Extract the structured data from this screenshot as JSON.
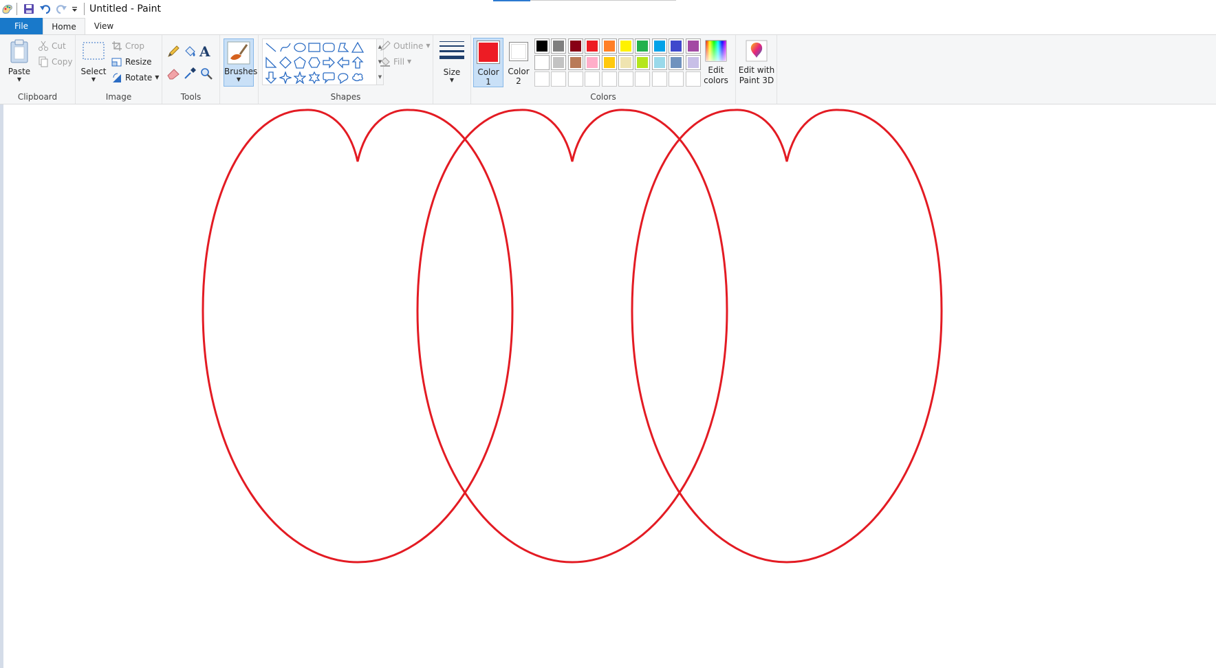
{
  "window": {
    "title": "Untitled - Paint"
  },
  "quick_access": {
    "icons": [
      "paint-app-icon",
      "save-icon",
      "undo-icon",
      "redo-icon",
      "customize-dropdown-icon"
    ]
  },
  "tabs": [
    {
      "label": "File",
      "active": false,
      "highlight": true
    },
    {
      "label": "Home",
      "active": true
    },
    {
      "label": "View",
      "active": false
    }
  ],
  "ribbon": {
    "clipboard": {
      "label": "Clipboard",
      "paste": "Paste",
      "cut": "Cut",
      "copy": "Copy"
    },
    "image": {
      "label": "Image",
      "select": "Select",
      "crop": "Crop",
      "resize": "Resize",
      "rotate": "Rotate"
    },
    "tools": {
      "label": "Tools",
      "icons": [
        "pencil-icon",
        "fill-bucket-icon",
        "text-icon",
        "eraser-icon",
        "color-picker-icon",
        "magnifier-icon"
      ]
    },
    "brushes": {
      "label": "Brushes"
    },
    "shapes": {
      "label": "Shapes",
      "outline": "Outline",
      "fill": "Fill",
      "items": [
        "line",
        "curve",
        "oval",
        "rectangle",
        "rounded-rectangle",
        "polygon",
        "triangle",
        "right-triangle",
        "diamond",
        "pentagon",
        "hexagon",
        "right-arrow",
        "left-arrow",
        "up-arrow",
        "down-arrow",
        "four-point-star",
        "five-point-star",
        "six-point-star",
        "rounded-callout",
        "oval-callout",
        "cloud-callout"
      ]
    },
    "size": {
      "label": "Size"
    },
    "colors": {
      "label": "Colors",
      "color1_label_line1": "Color",
      "color1_label_line2": "1",
      "color2_label_line1": "Color",
      "color2_label_line2": "2",
      "color1": "#ed1c24",
      "color2": "#ffffff",
      "palette_row1": [
        "#000000",
        "#7f7f7f",
        "#880015",
        "#ed1c24",
        "#ff7f27",
        "#fff200",
        "#22b14c",
        "#00a2e8",
        "#3f48cc",
        "#a349a4"
      ],
      "palette_row2": [
        "#ffffff",
        "#c3c3c3",
        "#b97a57",
        "#ffaec9",
        "#ffc90e",
        "#efe4b0",
        "#b5e61d",
        "#99d9ea",
        "#7092be",
        "#c8bfe7"
      ],
      "palette_row3_count": 10,
      "edit_colors_line1": "Edit",
      "edit_colors_line2": "colors"
    },
    "paint3d": {
      "line1": "Edit with",
      "line2": "Paint 3D"
    }
  },
  "canvas": {
    "stroke_color": "#e31b23",
    "shape_count": 3
  }
}
